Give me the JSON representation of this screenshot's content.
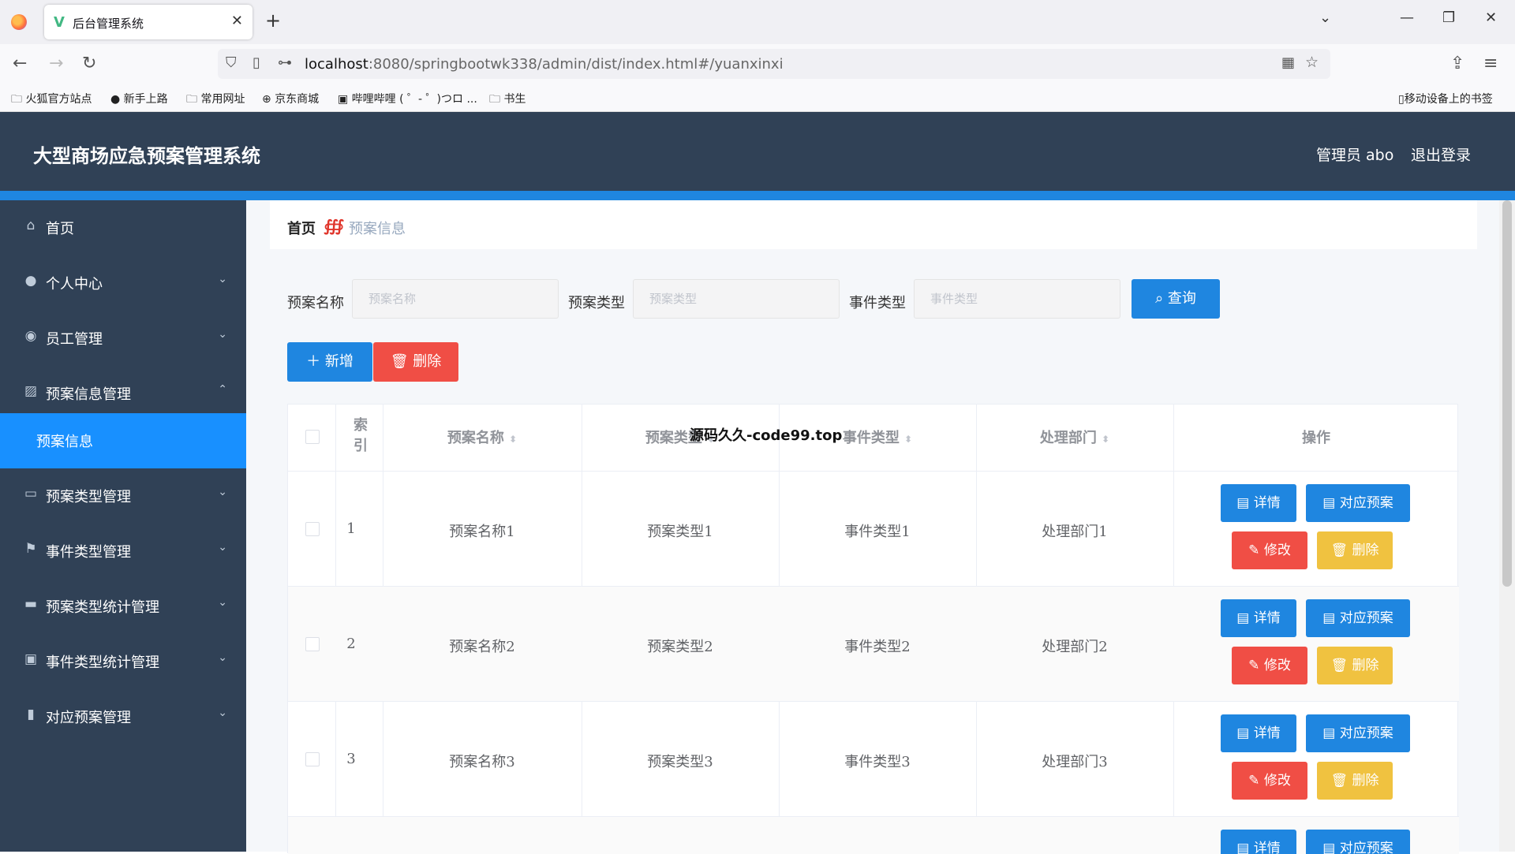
{
  "browser": {
    "tab_title": "后台管理系统",
    "url_host": "localhost",
    "url_rest": ":8080/springbootwk338/admin/dist/index.html#/yuanxinxi",
    "bookmarks": [
      "火狐官方站点",
      "新手上路",
      "常用网址",
      "京东商城",
      "哔哩哔哩 ( ゜- ゜)つロ ...",
      "书生"
    ],
    "mobile_bookmarks": "移动设备上的书签"
  },
  "header": {
    "title": "大型商场应急预案管理系统",
    "user_label": "管理员 abo",
    "logout_label": "退出登录"
  },
  "sidebar": {
    "items": [
      {
        "label": "首页",
        "icon": "home-icon"
      },
      {
        "label": "个人中心",
        "icon": "user-icon"
      },
      {
        "label": "员工管理",
        "icon": "location-icon"
      },
      {
        "label": "预案信息管理",
        "icon": "chart-icon"
      },
      {
        "label": "预案信息",
        "icon": ""
      },
      {
        "label": "预案类型管理",
        "icon": "document-icon"
      },
      {
        "label": "事件类型管理",
        "icon": "flag-icon"
      },
      {
        "label": "预案类型统计管理",
        "icon": "monitor-icon"
      },
      {
        "label": "事件类型统计管理",
        "icon": "clipboard-icon"
      },
      {
        "label": "对应预案管理",
        "icon": "bar-chart-icon"
      }
    ]
  },
  "breadcrumb": {
    "home": "首页",
    "current": "预案信息"
  },
  "search": {
    "fields": [
      {
        "label": "预案名称",
        "placeholder": "预案名称"
      },
      {
        "label": "预案类型",
        "placeholder": "预案类型"
      },
      {
        "label": "事件类型",
        "placeholder": "事件类型"
      }
    ],
    "query_label": "查询"
  },
  "actions": {
    "add_label": "新增",
    "delete_label": "删除"
  },
  "table": {
    "headers": {
      "index": "索\n引",
      "name": "预案名称",
      "type": "预案类型",
      "event": "事件类型",
      "dept": "处理部门",
      "ops": "操作"
    },
    "overlay_text": "源码久久-code99.top",
    "rows": [
      {
        "index": "1",
        "name": "预案名称1",
        "type": "预案类型1",
        "event": "事件类型1",
        "dept": "处理部门1"
      },
      {
        "index": "2",
        "name": "预案名称2",
        "type": "预案类型2",
        "event": "事件类型2",
        "dept": "处理部门2"
      },
      {
        "index": "3",
        "name": "预案名称3",
        "type": "预案类型3",
        "event": "事件类型3",
        "dept": "处理部门3"
      }
    ],
    "row_buttons": {
      "detail": "详情",
      "plan": "对应预案",
      "edit": "修改",
      "delete": "删除"
    },
    "partial_row_buttons": {
      "detail": "详情",
      "plan": "对应预案"
    }
  },
  "colors": {
    "header_bg": "#304156",
    "accent_blue": "#1f86e0",
    "danger_red": "#f04e45",
    "warning_orange": "#f0c240"
  }
}
